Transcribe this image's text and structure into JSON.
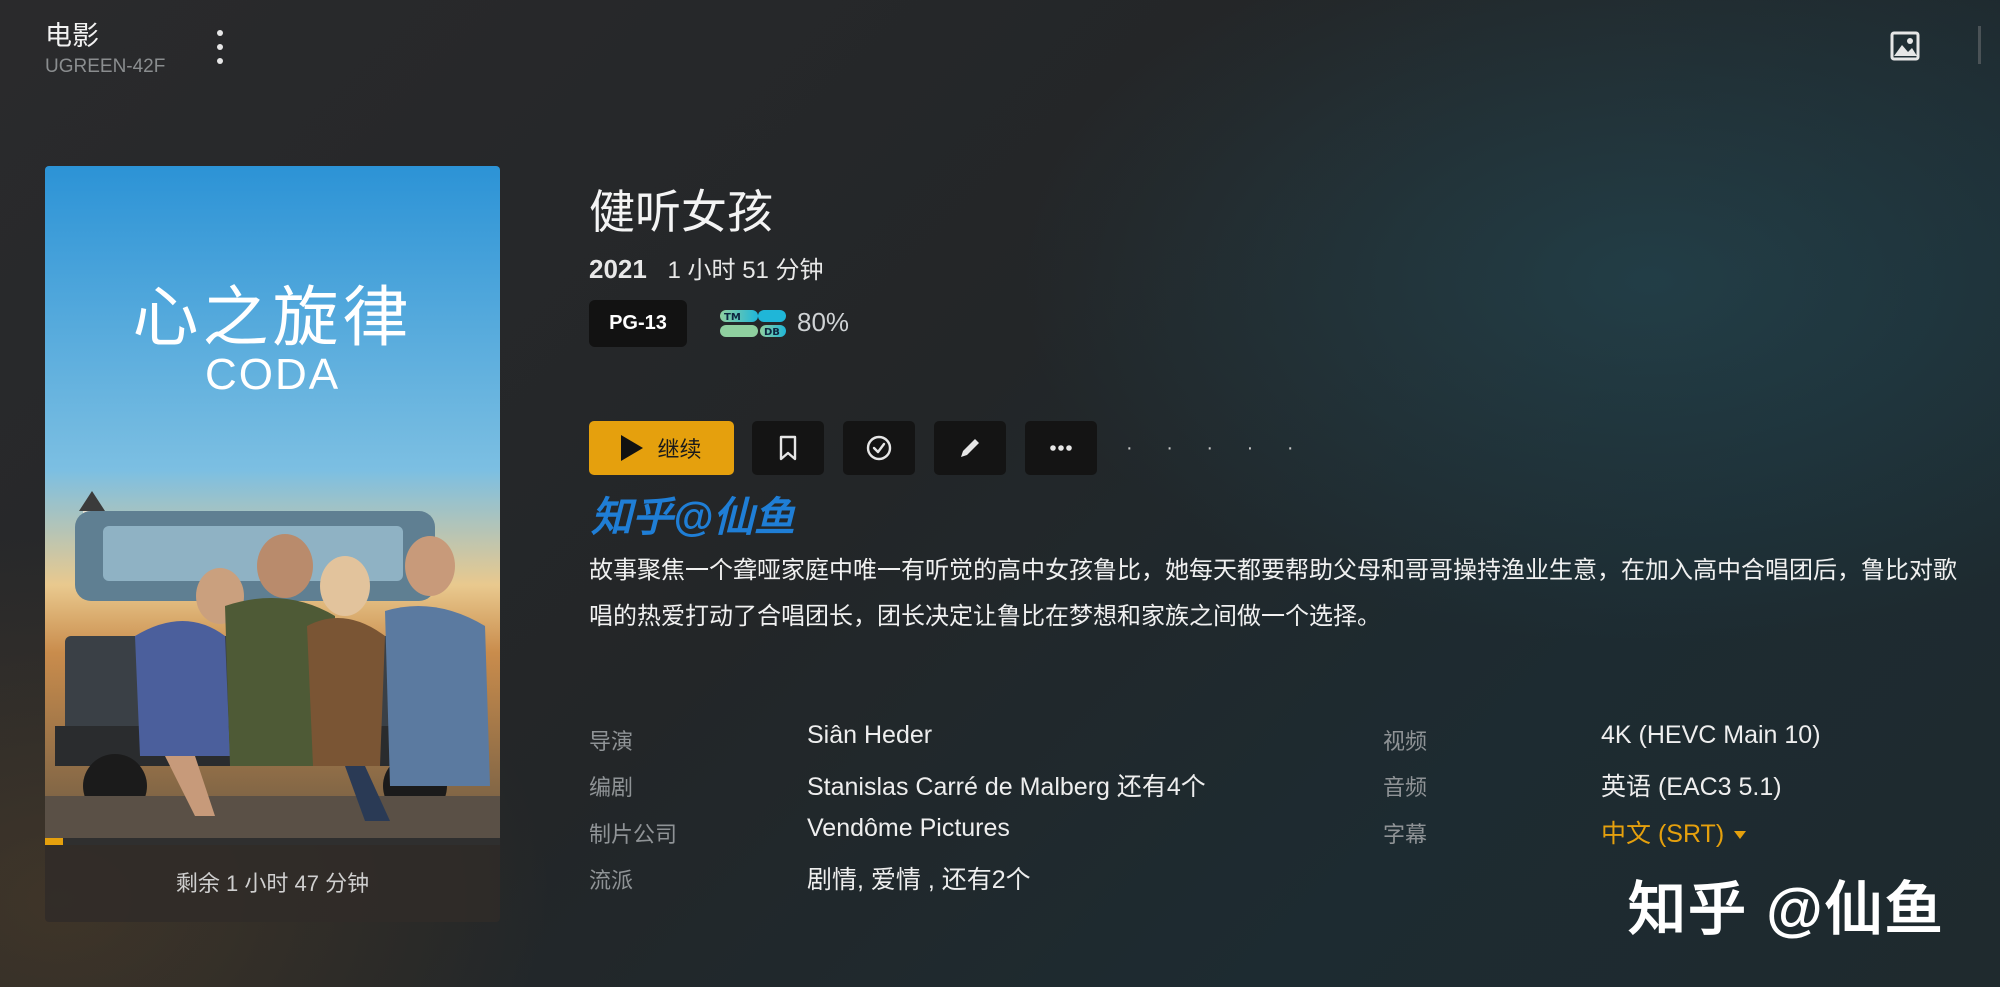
{
  "header": {
    "library_title": "电影",
    "server_name": "UGREEN-42F"
  },
  "poster": {
    "title_cn": "心之旋律",
    "title_en": "CODA",
    "remaining": "剩余 1 小时 47 分钟",
    "watch_progress_fraction": 0.04
  },
  "movie": {
    "title": "健听女孩",
    "year": "2021",
    "runtime": "1 小时 51 分钟",
    "content_rating": "PG-13",
    "tmdb_score": "80%",
    "summary": "故事聚焦一个聋哑家庭中唯一有听觉的高中女孩鲁比，她每天都要帮助父母和哥哥操持渔业生意，在加入高中合唱团后，鲁比对歌唱的热爱打动了合唱团长，团长决定让鲁比在梦想和家族之间做一个选择。"
  },
  "actions": {
    "play_label": "继续",
    "more_dots": "· · · · ·"
  },
  "watermarks": {
    "blue": "知乎@仙鱼",
    "bottom": "知乎 @仙鱼"
  },
  "credits": [
    {
      "label": "导演",
      "value": "Siân Heder"
    },
    {
      "label": "编剧",
      "value": "Stanislas Carré de Malberg  还有4个"
    },
    {
      "label": "制片公司",
      "value": "Vendôme Pictures"
    },
    {
      "label": "流派",
      "value": "剧情, 爱情 , 还有2个"
    }
  ],
  "media": [
    {
      "label": "视频",
      "value": "4K (HEVC Main 10)"
    },
    {
      "label": "音频",
      "value": "英语 (EAC3 5.1)"
    },
    {
      "label": "字幕",
      "value": "中文 (SRT)"
    }
  ],
  "colors": {
    "accent": "#e5a00d",
    "watermark_blue": "#1f7ed6"
  },
  "icons": [
    "more-vertical-icon",
    "image-icon",
    "play-icon",
    "bookmark-icon",
    "check-circle-icon",
    "pencil-icon",
    "more-horizontal-icon",
    "tmdb-logo"
  ]
}
